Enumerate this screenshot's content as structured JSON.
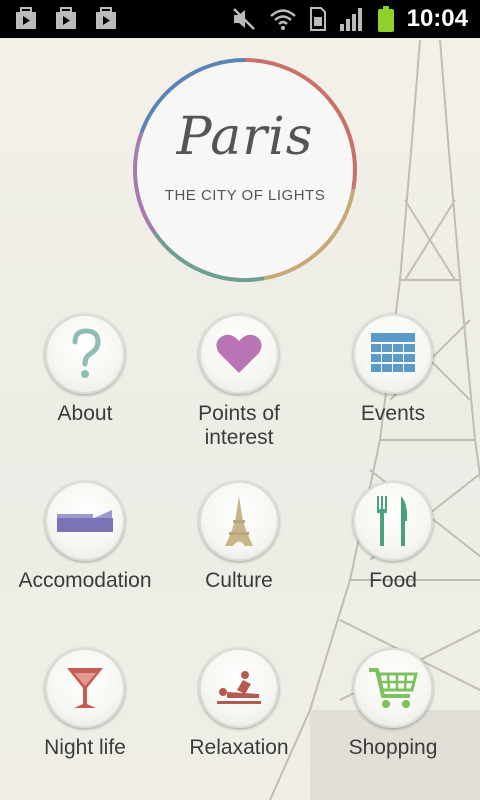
{
  "status_bar": {
    "time": "10:04",
    "icons": [
      "play-store-icon",
      "play-store-icon",
      "play-store-icon",
      "mute-icon",
      "wifi-icon",
      "sim-icon",
      "signal-icon",
      "battery-icon"
    ]
  },
  "logo": {
    "script": "Paris",
    "subtitle": "THE CITY OF LIGHTS"
  },
  "menu": {
    "items": [
      {
        "label": "About",
        "icon": "question-icon"
      },
      {
        "label": "Points of\ninterest",
        "icon": "heart-icon"
      },
      {
        "label": "Events",
        "icon": "calendar-icon"
      },
      {
        "label": "Accomodation",
        "icon": "bed-icon"
      },
      {
        "label": "Culture",
        "icon": "eiffel-tower-icon"
      },
      {
        "label": "Food",
        "icon": "fork-knife-icon"
      },
      {
        "label": "Night life",
        "icon": "cocktail-icon"
      },
      {
        "label": "Relaxation",
        "icon": "massage-icon"
      },
      {
        "label": "Shopping",
        "icon": "shopping-cart-icon"
      }
    ]
  },
  "colors": {
    "ring": [
      "#c8716b",
      "#c9a878",
      "#6f9e92",
      "#a77bb0",
      "#5c83b8"
    ],
    "heart": "#b874b5",
    "calendar": "#5b9bc9",
    "question": "#8fbcb4",
    "bed": "#7a74b6",
    "tower": "#c8b589",
    "food": "#4aa27c",
    "cocktail": "#c75b56",
    "massage": "#b55a4f",
    "cart": "#7cc15b"
  }
}
